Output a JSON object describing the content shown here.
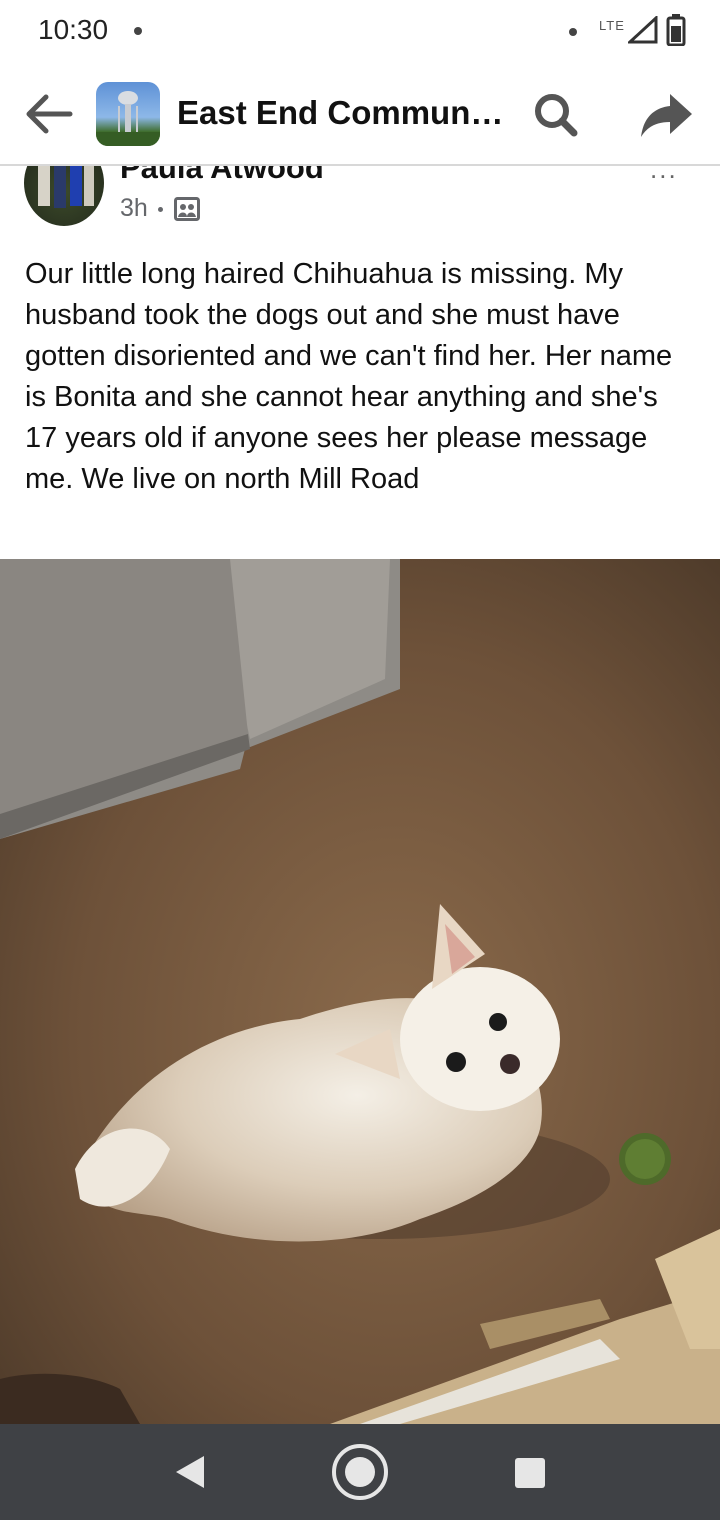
{
  "status_bar": {
    "time": "10:30",
    "network": "LTE"
  },
  "header": {
    "group_title": "East End Communit...",
    "icons": {
      "back": "back-arrow-icon",
      "search": "search-icon",
      "share": "share-icon"
    }
  },
  "post": {
    "author": "Paula Atwood",
    "time": "3h",
    "audience_icon": "group-members-icon",
    "more_label": "...",
    "text": "Our little long haired Chihuahua is missing. My husband took the dogs out and she must have gotten disoriented and we can't find her. Her name is Bonita and she cannot hear anything and she's 17 years old if anyone sees her please message me. We live on north Mill Road"
  },
  "nav_bar": {
    "icons": {
      "back": "nav-back-icon",
      "home": "nav-home-icon",
      "recents": "nav-recents-icon"
    }
  }
}
